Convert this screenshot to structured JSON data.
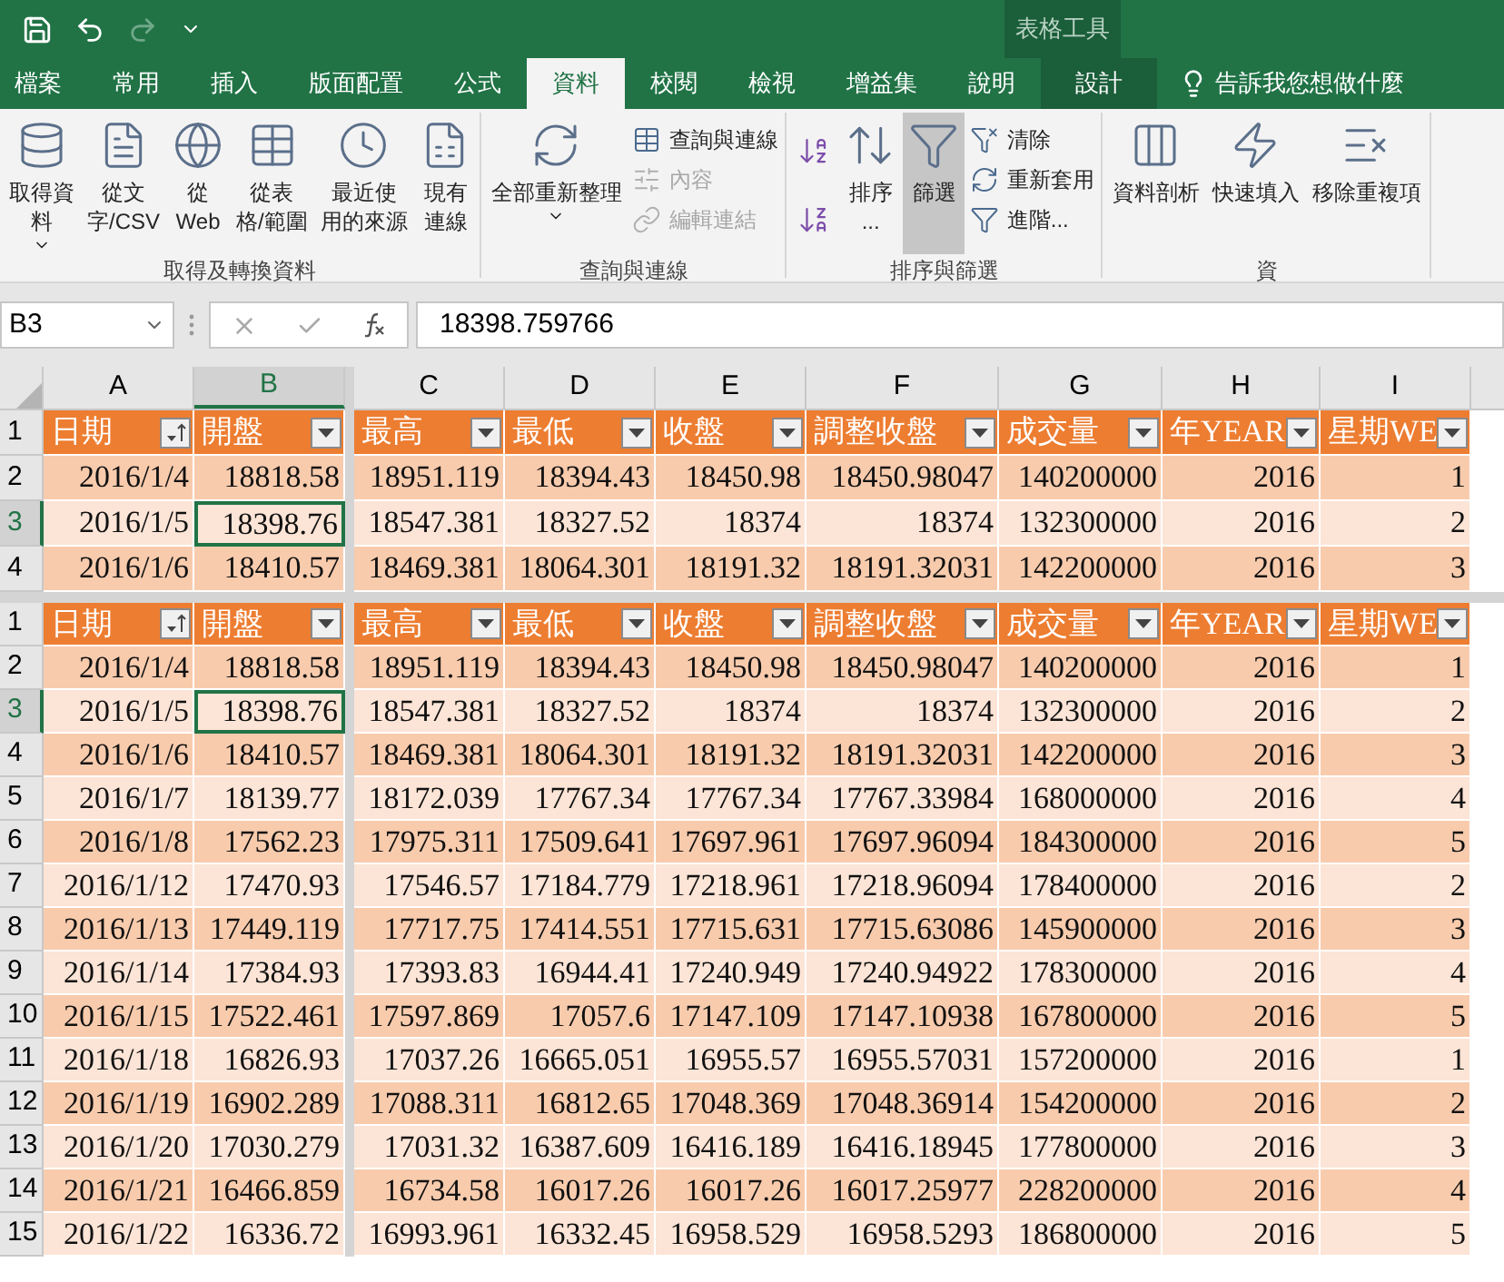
{
  "title_bar": {
    "contextual_title": "表格工具"
  },
  "tabs": [
    {
      "label": "檔案",
      "selected": false,
      "kind": "normal"
    },
    {
      "label": "常用",
      "selected": false,
      "kind": "normal"
    },
    {
      "label": "插入",
      "selected": false,
      "kind": "normal"
    },
    {
      "label": "版面配置",
      "selected": false,
      "kind": "normal"
    },
    {
      "label": "公式",
      "selected": false,
      "kind": "normal"
    },
    {
      "label": "資料",
      "selected": true,
      "kind": "normal"
    },
    {
      "label": "校閱",
      "selected": false,
      "kind": "normal"
    },
    {
      "label": "檢視",
      "selected": false,
      "kind": "normal"
    },
    {
      "label": "增益集",
      "selected": false,
      "kind": "normal"
    },
    {
      "label": "說明",
      "selected": false,
      "kind": "normal"
    },
    {
      "label": "設計",
      "selected": false,
      "kind": "contextual"
    }
  ],
  "tell_me": "告訴我您想做什麼",
  "ribbon_groups": [
    {
      "label": "取得及轉換資料",
      "buttons": [
        {
          "kind": "large",
          "lines": [
            "取得資",
            "料"
          ],
          "dropdown": true,
          "disabled": false,
          "selected": false
        },
        {
          "kind": "large",
          "lines": [
            "從文",
            "字/CSV"
          ],
          "disabled": false,
          "selected": false
        },
        {
          "kind": "large",
          "lines": [
            "從",
            "Web"
          ],
          "disabled": false,
          "selected": false
        },
        {
          "kind": "large",
          "lines": [
            "從表",
            "格/範圍"
          ],
          "disabled": false,
          "selected": false
        },
        {
          "kind": "large",
          "lines": [
            "最近使",
            "用的來源"
          ],
          "disabled": false,
          "selected": false
        },
        {
          "kind": "large",
          "lines": [
            "現有",
            "連線"
          ],
          "disabled": false,
          "selected": false
        }
      ]
    },
    {
      "label": "查詢與連線",
      "buttons": [
        {
          "kind": "large",
          "lines": [
            "全部重新整理"
          ],
          "dropdown": true,
          "disabled": false,
          "selected": false
        },
        {
          "kind": "small",
          "lines": [
            "查詢與連線"
          ],
          "disabled": false,
          "selected": false
        },
        {
          "kind": "small",
          "lines": [
            "內容"
          ],
          "disabled": true,
          "selected": false
        },
        {
          "kind": "small",
          "lines": [
            "編輯連結"
          ],
          "disabled": true,
          "selected": false
        }
      ]
    },
    {
      "label": "排序與篩選",
      "buttons": [
        {
          "kind": "icon",
          "disabled": false,
          "selected": false
        },
        {
          "kind": "icon",
          "disabled": false,
          "selected": false
        },
        {
          "kind": "large",
          "lines": [
            "排序",
            "..."
          ],
          "disabled": false,
          "selected": false
        },
        {
          "kind": "large",
          "lines": [
            "篩選"
          ],
          "disabled": false,
          "selected": true
        },
        {
          "kind": "small",
          "lines": [
            "清除"
          ],
          "disabled": false,
          "selected": false
        },
        {
          "kind": "small",
          "lines": [
            "重新套用"
          ],
          "disabled": false,
          "selected": false
        },
        {
          "kind": "small",
          "lines": [
            "進階..."
          ],
          "disabled": false,
          "selected": false
        }
      ]
    },
    {
      "label": "資",
      "buttons": [
        {
          "kind": "large",
          "lines": [
            "資料剖析"
          ],
          "disabled": false,
          "selected": false
        },
        {
          "kind": "large",
          "lines": [
            "快速填入"
          ],
          "disabled": false,
          "selected": false
        },
        {
          "kind": "large",
          "lines": [
            "移除重複項"
          ],
          "disabled": false,
          "selected": false
        }
      ]
    }
  ],
  "formula_bar": {
    "name_box": "B3",
    "formula": "18398.759766"
  },
  "columns": [
    {
      "label": "A",
      "selected": false
    },
    {
      "label": "B",
      "selected": true
    },
    {
      "label": "C",
      "selected": false
    },
    {
      "label": "D",
      "selected": false
    },
    {
      "label": "E",
      "selected": false
    },
    {
      "label": "F",
      "selected": false
    },
    {
      "label": "G",
      "selected": false
    },
    {
      "label": "H",
      "selected": false
    },
    {
      "label": "I",
      "selected": false
    }
  ],
  "panes": [
    {
      "header": {
        "row": "1",
        "cells": [
          {
            "label": "日期",
            "kind": "sorted"
          },
          {
            "label": "開盤",
            "kind": "dropdown"
          },
          {
            "label": "最高",
            "kind": "dropdown"
          },
          {
            "label": "最低",
            "kind": "dropdown"
          },
          {
            "label": "收盤",
            "kind": "dropdown"
          },
          {
            "label": "調整收盤",
            "kind": "dropdown"
          },
          {
            "label": "成交量",
            "kind": "dropdown"
          },
          {
            "label": "年YEAR",
            "kind": "dropdown"
          },
          {
            "label": "星期WE",
            "kind": "dropdown"
          }
        ]
      },
      "rows": [
        {
          "row": "2",
          "selected": false,
          "cells": [
            "2016/1/4",
            "18818.58",
            "18951.119",
            "18394.43",
            "18450.98",
            "18450.98047",
            "140200000",
            "2016",
            "1"
          ]
        },
        {
          "row": "3",
          "selected": true,
          "cells": [
            "2016/1/5",
            "18398.76",
            "18547.381",
            "18327.52",
            "18374",
            "18374",
            "132300000",
            "2016",
            "2"
          ]
        },
        {
          "row": "4",
          "selected": false,
          "cells": [
            "2016/1/6",
            "18410.57",
            "18469.381",
            "18064.301",
            "18191.32",
            "18191.32031",
            "142200000",
            "2016",
            "3"
          ]
        }
      ]
    },
    {
      "header": {
        "row": "1",
        "cells": [
          {
            "label": "日期",
            "kind": "sorted"
          },
          {
            "label": "開盤",
            "kind": "dropdown"
          },
          {
            "label": "最高",
            "kind": "dropdown"
          },
          {
            "label": "最低",
            "kind": "dropdown"
          },
          {
            "label": "收盤",
            "kind": "dropdown"
          },
          {
            "label": "調整收盤",
            "kind": "dropdown"
          },
          {
            "label": "成交量",
            "kind": "dropdown"
          },
          {
            "label": "年YEAR",
            "kind": "dropdown"
          },
          {
            "label": "星期WE",
            "kind": "dropdown"
          }
        ]
      },
      "rows": [
        {
          "row": "2",
          "selected": false,
          "cells": [
            "2016/1/4",
            "18818.58",
            "18951.119",
            "18394.43",
            "18450.98",
            "18450.98047",
            "140200000",
            "2016",
            "1"
          ]
        },
        {
          "row": "3",
          "selected": true,
          "cells": [
            "2016/1/5",
            "18398.76",
            "18547.381",
            "18327.52",
            "18374",
            "18374",
            "132300000",
            "2016",
            "2"
          ]
        },
        {
          "row": "4",
          "selected": false,
          "cells": [
            "2016/1/6",
            "18410.57",
            "18469.381",
            "18064.301",
            "18191.32",
            "18191.32031",
            "142200000",
            "2016",
            "3"
          ]
        },
        {
          "row": "5",
          "selected": false,
          "cells": [
            "2016/1/7",
            "18139.77",
            "18172.039",
            "17767.34",
            "17767.34",
            "17767.33984",
            "168000000",
            "2016",
            "4"
          ]
        },
        {
          "row": "6",
          "selected": false,
          "cells": [
            "2016/1/8",
            "17562.23",
            "17975.311",
            "17509.641",
            "17697.961",
            "17697.96094",
            "184300000",
            "2016",
            "5"
          ]
        },
        {
          "row": "7",
          "selected": false,
          "cells": [
            "2016/1/12",
            "17470.93",
            "17546.57",
            "17184.779",
            "17218.961",
            "17218.96094",
            "178400000",
            "2016",
            "2"
          ]
        },
        {
          "row": "8",
          "selected": false,
          "cells": [
            "2016/1/13",
            "17449.119",
            "17717.75",
            "17414.551",
            "17715.631",
            "17715.63086",
            "145900000",
            "2016",
            "3"
          ]
        },
        {
          "row": "9",
          "selected": false,
          "cells": [
            "2016/1/14",
            "17384.93",
            "17393.83",
            "16944.41",
            "17240.949",
            "17240.94922",
            "178300000",
            "2016",
            "4"
          ]
        },
        {
          "row": "10",
          "selected": false,
          "cells": [
            "2016/1/15",
            "17522.461",
            "17597.869",
            "17057.6",
            "17147.109",
            "17147.10938",
            "167800000",
            "2016",
            "5"
          ]
        },
        {
          "row": "11",
          "selected": false,
          "cells": [
            "2016/1/18",
            "16826.93",
            "17037.26",
            "16665.051",
            "16955.57",
            "16955.57031",
            "157200000",
            "2016",
            "1"
          ]
        },
        {
          "row": "12",
          "selected": false,
          "cells": [
            "2016/1/19",
            "16902.289",
            "17088.311",
            "16812.65",
            "17048.369",
            "17048.36914",
            "154200000",
            "2016",
            "2"
          ]
        },
        {
          "row": "13",
          "selected": false,
          "cells": [
            "2016/1/20",
            "17030.279",
            "17031.32",
            "16387.609",
            "16416.189",
            "16416.18945",
            "177800000",
            "2016",
            "3"
          ]
        },
        {
          "row": "14",
          "selected": false,
          "cells": [
            "2016/1/21",
            "16466.859",
            "16734.58",
            "16017.26",
            "16017.26",
            "16017.25977",
            "228200000",
            "2016",
            "4"
          ]
        },
        {
          "row": "15",
          "selected": false,
          "cells": [
            "2016/1/22",
            "16336.72",
            "16993.961",
            "16332.45",
            "16958.529",
            "16958.5293",
            "186800000",
            "2016",
            "5"
          ]
        }
      ]
    }
  ]
}
